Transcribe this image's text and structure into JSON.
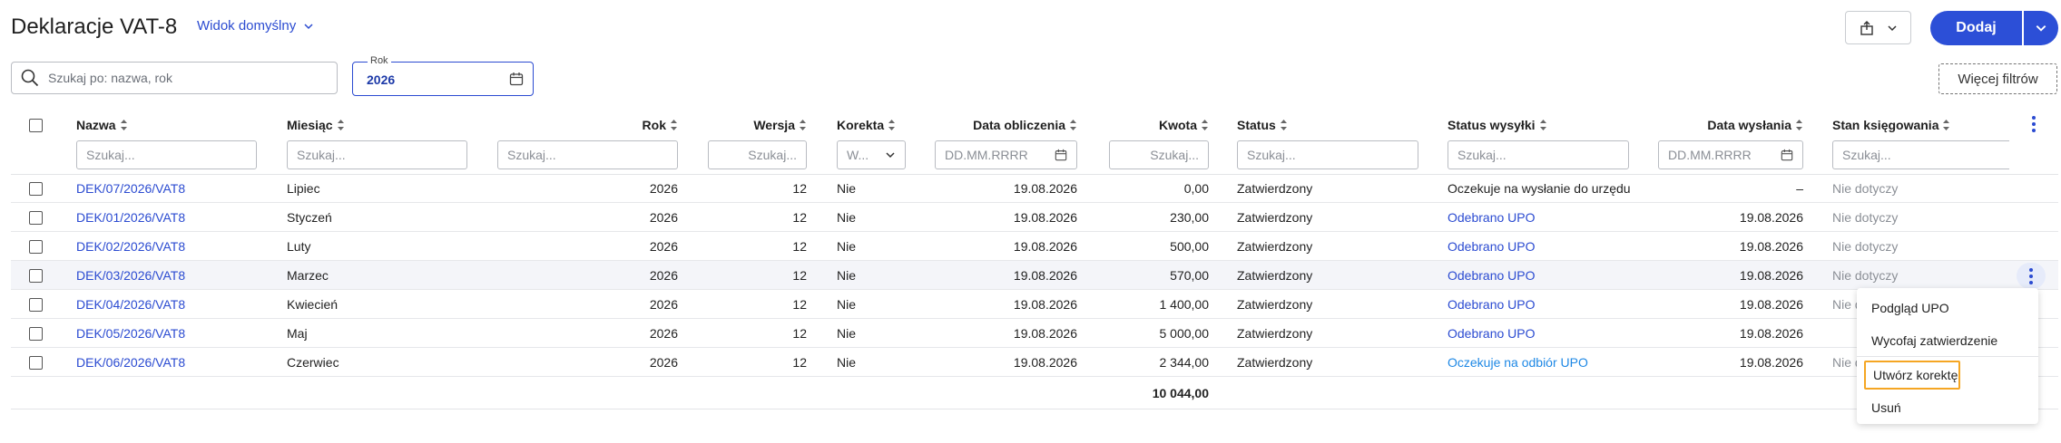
{
  "header": {
    "title": "Deklaracje VAT-8",
    "view_label": "Widok domyślny",
    "add_label": "Dodaj"
  },
  "filters": {
    "search_placeholder": "Szukaj po: nazwa, rok",
    "year_label": "Rok",
    "year_value": "2026",
    "more_filters": "Więcej filtrów"
  },
  "columns": {
    "nazwa": "Nazwa",
    "miesiac": "Miesiąc",
    "rok": "Rok",
    "wersja": "Wersja",
    "korekta": "Korekta",
    "data_obliczenia": "Data obliczenia",
    "kwota": "Kwota",
    "status": "Status",
    "status_wysylki": "Status wysyłki",
    "data_wyslania": "Data wysłania",
    "stan_ksiegowania": "Stan księgowania"
  },
  "column_filters": {
    "text_placeholder": "Szukaj...",
    "date_placeholder": "DD.MM.RRRR",
    "korekta_value": "W..."
  },
  "rows": [
    {
      "nazwa": "DEK/07/2026/VAT8",
      "miesiac": "Lipiec",
      "rok": "2026",
      "wersja": "12",
      "korekta": "Nie",
      "data_obliczenia": "19.08.2026",
      "kwota": "0,00",
      "status": "Zatwierdzony",
      "status_wysylki": "Oczekuje na wysłanie do urzędu",
      "data_wyslania": "–",
      "stan": "Nie dotyczy"
    },
    {
      "nazwa": "DEK/01/2026/VAT8",
      "miesiac": "Styczeń",
      "rok": "2026",
      "wersja": "12",
      "korekta": "Nie",
      "data_obliczenia": "19.08.2026",
      "kwota": "230,00",
      "status": "Zatwierdzony",
      "status_wysylki": "Odebrano UPO",
      "data_wyslania": "19.08.2026",
      "stan": "Nie dotyczy"
    },
    {
      "nazwa": "DEK/02/2026/VAT8",
      "miesiac": "Luty",
      "rok": "2026",
      "wersja": "12",
      "korekta": "Nie",
      "data_obliczenia": "19.08.2026",
      "kwota": "500,00",
      "status": "Zatwierdzony",
      "status_wysylki": "Odebrano UPO",
      "data_wyslania": "19.08.2026",
      "stan": "Nie dotyczy"
    },
    {
      "nazwa": "DEK/03/2026/VAT8",
      "miesiac": "Marzec",
      "rok": "2026",
      "wersja": "12",
      "korekta": "Nie",
      "data_obliczenia": "19.08.2026",
      "kwota": "570,00",
      "status": "Zatwierdzony",
      "status_wysylki": "Odebrano UPO",
      "data_wyslania": "19.08.2026",
      "stan": "Nie dotyczy"
    },
    {
      "nazwa": "DEK/04/2026/VAT8",
      "miesiac": "Kwiecień",
      "rok": "2026",
      "wersja": "12",
      "korekta": "Nie",
      "data_obliczenia": "19.08.2026",
      "kwota": "1 400,00",
      "status": "Zatwierdzony",
      "status_wysylki": "Odebrano UPO",
      "data_wyslania": "19.08.2026",
      "stan": "Nie d"
    },
    {
      "nazwa": "DEK/05/2026/VAT8",
      "miesiac": "Maj",
      "rok": "2026",
      "wersja": "12",
      "korekta": "Nie",
      "data_obliczenia": "19.08.2026",
      "kwota": "5 000,00",
      "status": "Zatwierdzony",
      "status_wysylki": "Odebrano UPO",
      "data_wyslania": "19.08.2026",
      "stan": ""
    },
    {
      "nazwa": "DEK/06/2026/VAT8",
      "miesiac": "Czerwiec",
      "rok": "2026",
      "wersja": "12",
      "korekta": "Nie",
      "data_obliczenia": "19.08.2026",
      "kwota": "2 344,00",
      "status": "Zatwierdzony",
      "status_wysylki": "Oczekuje na odbiór UPO",
      "data_wyslania": "19.08.2026",
      "stan": "Nie d"
    }
  ],
  "total": "10 044,00",
  "context_menu": {
    "items": [
      "Podgląd UPO",
      "Wycofaj zatwierdzenie",
      "Utwórz korektę",
      "Usuń"
    ]
  },
  "colors": {
    "primary": "#2c4fd7",
    "link": "#2b4bd1",
    "link_light": "#1e88e5",
    "focus": "#f5a623"
  }
}
